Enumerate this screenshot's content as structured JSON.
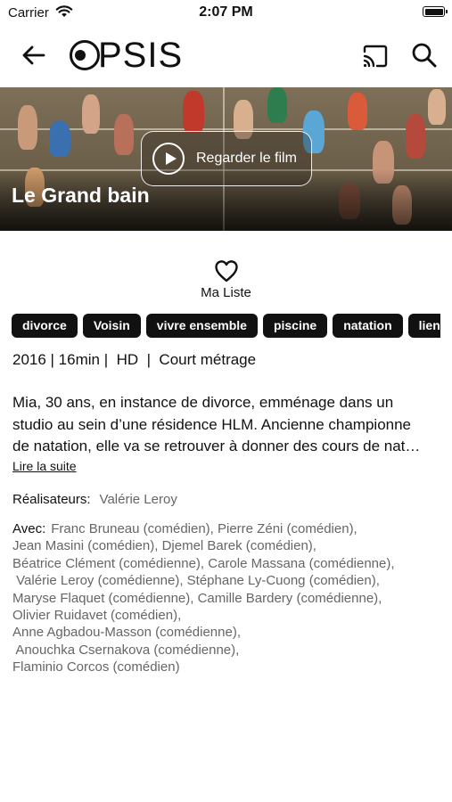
{
  "status_bar": {
    "carrier": "Carrier",
    "time": "2:07 PM"
  },
  "nav": {
    "logo_text": "PSIS",
    "icons": [
      "back-arrow-icon",
      "cast-icon",
      "search-icon"
    ]
  },
  "hero": {
    "play_label": "Regarder le film",
    "title": "Le Grand bain"
  },
  "my_list": {
    "label": "Ma Liste"
  },
  "tags": [
    "divorce",
    "Voisin",
    "vivre ensemble",
    "piscine",
    "natation",
    "lien"
  ],
  "meta": {
    "text": "2016 | 16min |  HD  |  Court métrage"
  },
  "synopsis": {
    "lines": [
      "Mia, 30 ans, en instance de divorce, emménage dans un",
      "studio au sein d’une résidence HLM. Ancienne championne",
      "de natation, elle va se retrouver à donner des cours de nat…"
    ],
    "read_more": "Lire la suite"
  },
  "directors": {
    "label": "Réalisateurs:",
    "value": "Valérie Leroy"
  },
  "cast": {
    "label": "Avec:",
    "lines": [
      "Franc Bruneau (comédien), Pierre Zéni (comédien),",
      "Jean Masini (comédien), Djemel Barek (comédien),",
      "Béatrice Clément (comédienne), Carole Massana (comédienne),",
      " Valérie Leroy (comédienne), Stéphane Ly-Cuong (comédien),",
      "Maryse Flaquet (comédienne), Camille Bardery (comédienne),",
      "Olivier Ruidavet (comédien),",
      "Anne Agbadou-Masson (comédienne),",
      " Anouchka Csernakova (comédienne),",
      "Flaminio Corcos (comédien)"
    ]
  }
}
